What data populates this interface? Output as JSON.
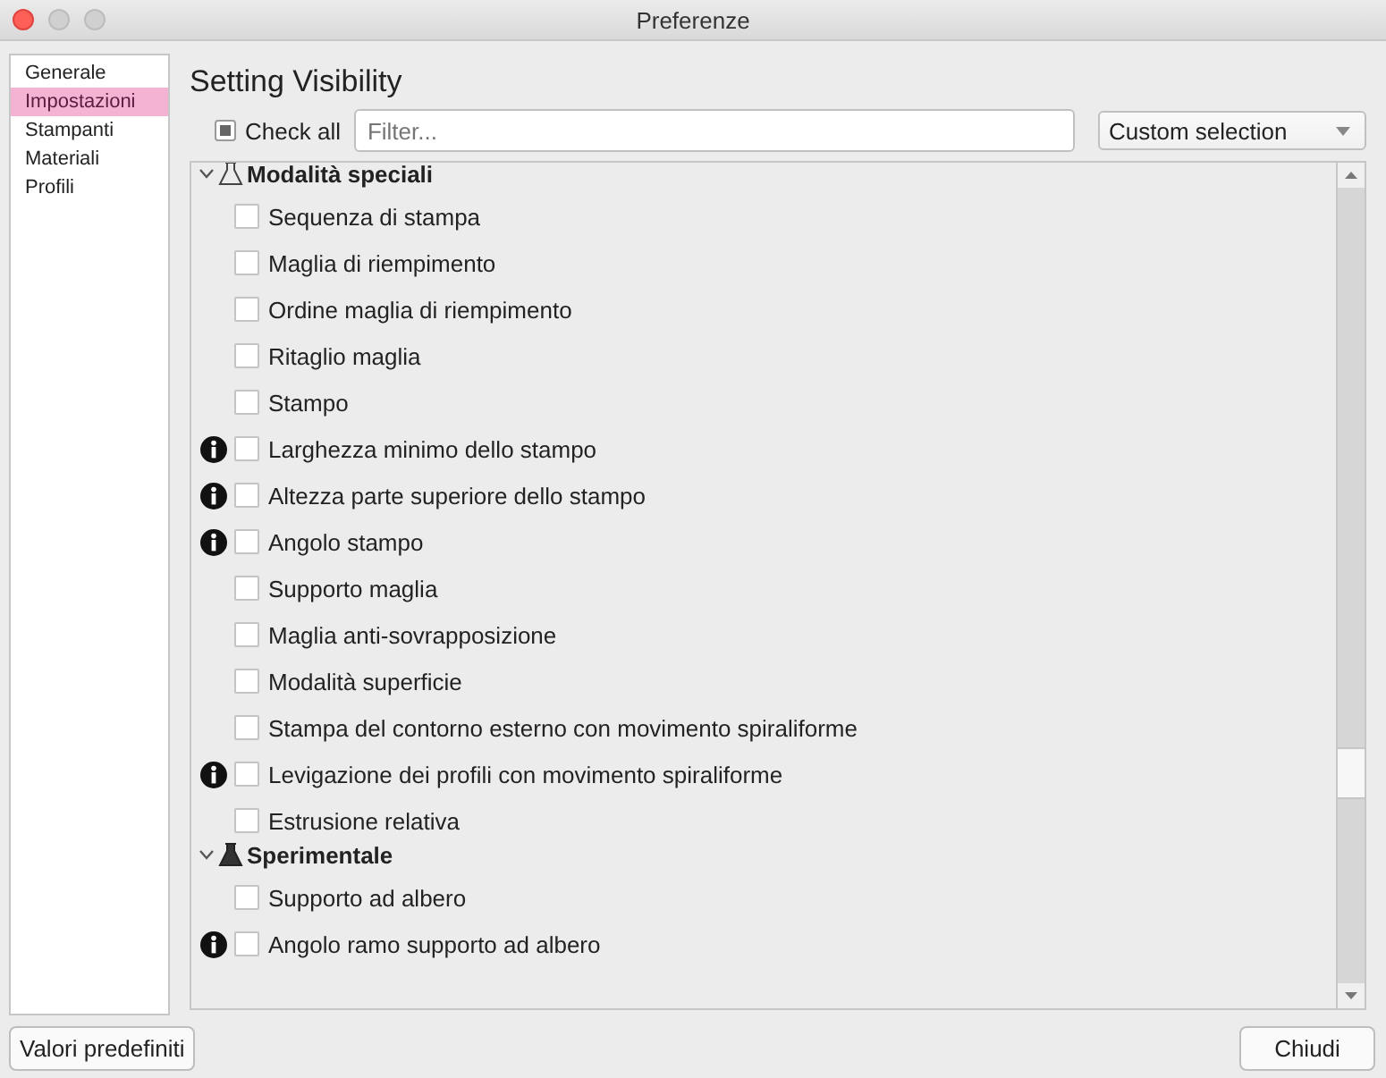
{
  "window": {
    "title": "Preferenze"
  },
  "sidebar": {
    "items": [
      {
        "label": "Generale",
        "selected": false
      },
      {
        "label": "Impostazioni",
        "selected": true
      },
      {
        "label": "Stampanti",
        "selected": false
      },
      {
        "label": "Materiali",
        "selected": false
      },
      {
        "label": "Profili",
        "selected": false
      }
    ]
  },
  "heading": "Setting Visibility",
  "check_all": {
    "label": "Check all",
    "checked": true
  },
  "filter": {
    "placeholder": "Filter..."
  },
  "preset": {
    "value": "Custom selection"
  },
  "groups": [
    {
      "title": "Modalità speciali",
      "kind": "special",
      "expanded": true,
      "settings": [
        {
          "label": "Sequenza di stampa",
          "info": false,
          "checked": false
        },
        {
          "label": "Maglia di riempimento",
          "info": false,
          "checked": false
        },
        {
          "label": "Ordine maglia di riempimento",
          "info": false,
          "checked": false
        },
        {
          "label": "Ritaglio maglia",
          "info": false,
          "checked": false
        },
        {
          "label": "Stampo",
          "info": false,
          "checked": false
        },
        {
          "label": "Larghezza minimo dello stampo",
          "info": true,
          "checked": false
        },
        {
          "label": "Altezza parte superiore dello stampo",
          "info": true,
          "checked": false
        },
        {
          "label": "Angolo stampo",
          "info": true,
          "checked": false
        },
        {
          "label": "Supporto maglia",
          "info": false,
          "checked": false
        },
        {
          "label": "Maglia anti-sovrapposizione",
          "info": false,
          "checked": false
        },
        {
          "label": "Modalità superficie",
          "info": false,
          "checked": false
        },
        {
          "label": "Stampa del contorno esterno con movimento spiraliforme",
          "info": false,
          "checked": false
        },
        {
          "label": "Levigazione dei profili con movimento spiraliforme",
          "info": true,
          "checked": false
        },
        {
          "label": "Estrusione relativa",
          "info": false,
          "checked": false
        }
      ]
    },
    {
      "title": "Sperimentale",
      "kind": "experimental",
      "expanded": true,
      "settings": [
        {
          "label": "Supporto ad albero",
          "info": false,
          "checked": false
        },
        {
          "label": "Angolo ramo supporto ad albero",
          "info": true,
          "checked": false
        }
      ]
    }
  ],
  "buttons": {
    "defaults": "Valori predefiniti",
    "close": "Chiudi"
  }
}
